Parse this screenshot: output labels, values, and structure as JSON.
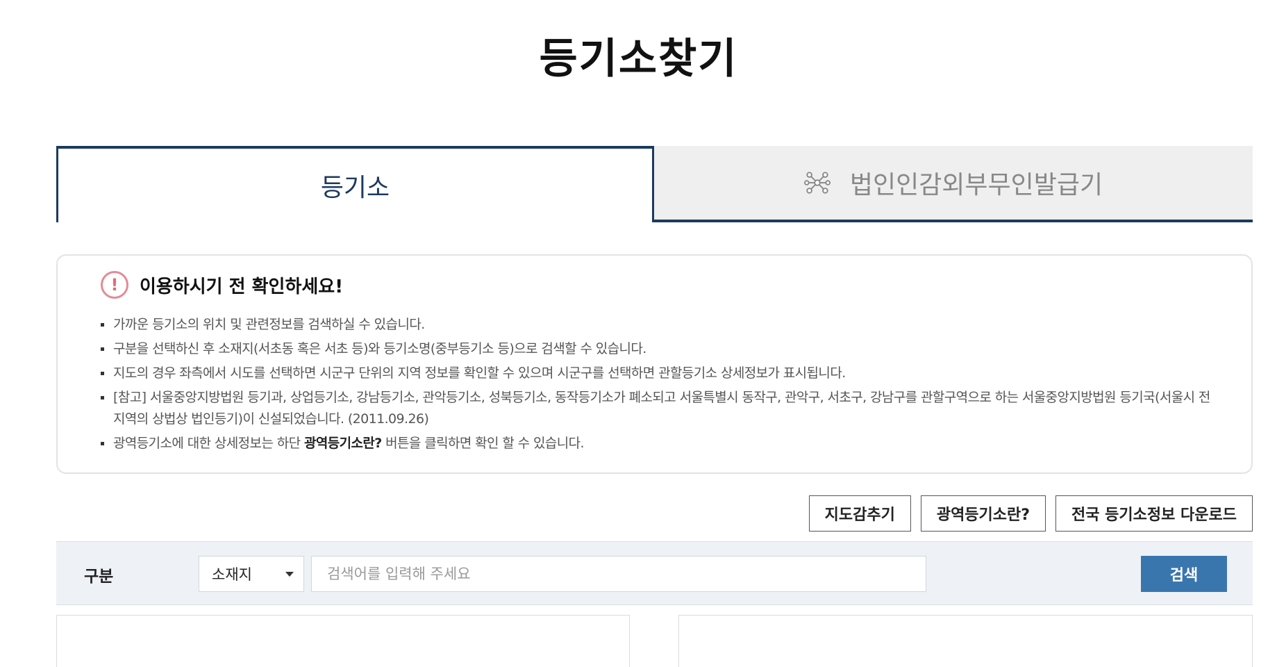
{
  "page": {
    "title": "등기소찾기"
  },
  "tabs": [
    {
      "label": "등기소",
      "active": true
    },
    {
      "label": "법인인감외부무인발급기",
      "active": false,
      "icon": "network-icon"
    }
  ],
  "notice": {
    "title": "이용하시기 전 확인하세요!",
    "icon": "alert-circle-icon",
    "items": [
      {
        "text": "가까운 등기소의 위치 및 관련정보를 검색하실 수 있습니다."
      },
      {
        "text": "구분을 선택하신 후 소재지(서초동 혹은 서초 등)와 등기소명(중부등기소 등)으로 검색할 수 있습니다."
      },
      {
        "text": "지도의 경우 좌측에서 시도를 선택하면 시군구 단위의 지역 정보를 확인할 수 있으며 시군구를 선택하면 관할등기소 상세정보가 표시됩니다."
      },
      {
        "text": "[참고] 서울중앙지방법원 등기과, 상업등기소, 강남등기소, 관악등기소, 성북등기소, 동작등기소가 폐소되고 서울특별시 동작구, 관악구, 서초구, 강남구를 관할구역으로 하는 서울중앙지방법원 등기국(서울시 전 지역의 상법상 법인등기)이 신설되었습니다. (2011.09.26)"
      },
      {
        "before": "광역등기소에 대한 상세정보는 하단 ",
        "bold": "광역등기소란?",
        "after": " 버튼을 클릭하면 확인 할 수 있습니다."
      }
    ]
  },
  "actions": {
    "hide_map": "지도감추기",
    "regional_info": "광역등기소란?",
    "download": "전국 등기소정보 다운로드"
  },
  "search": {
    "label": "구분",
    "select_value": "소재지",
    "placeholder": "검색어를 입력해 주세요",
    "button": "검색"
  },
  "colors": {
    "primary": "#1c3a5e",
    "button": "#3a76ae",
    "alert": "#e06b7a"
  }
}
